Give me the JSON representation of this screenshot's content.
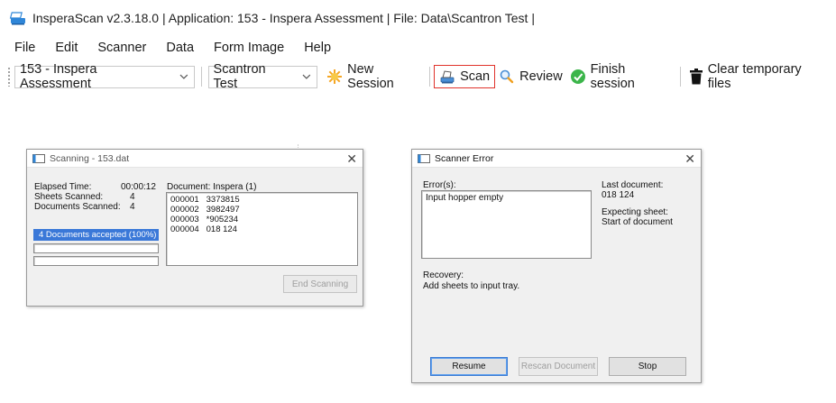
{
  "window": {
    "title": "InsperaScan v2.3.18.0   | Application: 153 - Inspera Assessment | File: Data\\Scantron Test |"
  },
  "menu": [
    "File",
    "Edit",
    "Scanner",
    "Data",
    "Form Image",
    "Help"
  ],
  "toolbar": {
    "application_select": "153 - Inspera Assessment",
    "file_select": "Scantron Test",
    "new_session": "New Session",
    "scan": "Scan",
    "review": "Review",
    "finish_session": "Finish session",
    "clear_temp": "Clear temporary files"
  },
  "scanning_dialog": {
    "title": "Scanning - 153.dat",
    "elapsed_label": "Elapsed Time:",
    "elapsed_value": "00:00:12",
    "sheets_label": "Sheets Scanned:",
    "sheets_value": "4",
    "docs_label": "Documents Scanned:",
    "docs_value": "4",
    "accepted_text": "4 Documents accepted (100%)",
    "document_label": "Document: Inspera (1)",
    "documents": [
      {
        "id": "000001",
        "code": "3373815"
      },
      {
        "id": "000002",
        "code": "3982497"
      },
      {
        "id": "000003",
        "code": "*905234"
      },
      {
        "id": "000004",
        "code": "018 124"
      }
    ],
    "end_button": "End Scanning"
  },
  "error_dialog": {
    "title": "Scanner Error",
    "errors_label": "Error(s):",
    "error_text": "Input hopper empty",
    "last_doc_label": "Last document:",
    "last_doc_value": "018 124",
    "expecting_label": "Expecting sheet:",
    "expecting_value": "Start of document",
    "recovery_label": "Recovery:",
    "recovery_text": "Add sheets to input tray.",
    "resume_button": "Resume",
    "rescan_button": "Rescan Document",
    "stop_button": "Stop"
  }
}
